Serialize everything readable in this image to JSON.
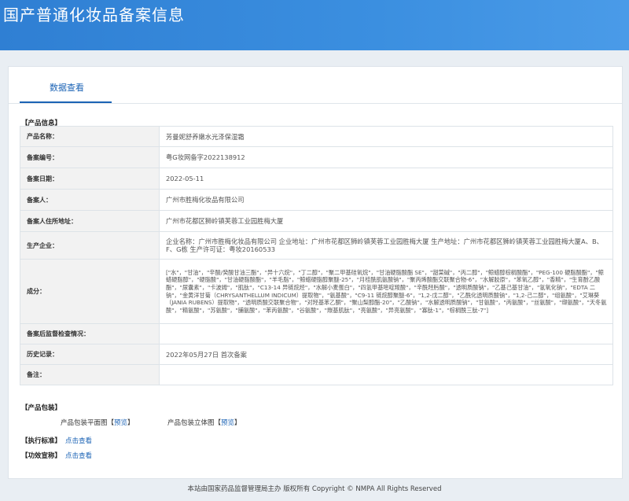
{
  "header": {
    "title": "国产普通化妆品备案信息"
  },
  "tab": {
    "label": "数据查看"
  },
  "product_section": {
    "title": "【产品信息】"
  },
  "rows": [
    {
      "label": "产品名称：",
      "value": "芳曼妮舒养嫩水光泽保湿霜"
    },
    {
      "label": "备案编号：",
      "value": "粤G妆网备字2022138912"
    },
    {
      "label": "备案日期：",
      "value": "2022-05-11"
    },
    {
      "label": "备案人：",
      "value": "广州市胜梅化妆品有限公司"
    },
    {
      "label": "备案人住所地址：",
      "value": "广州市花都区狮岭镇芙蓉工业园胜梅大厦"
    },
    {
      "label": "生产企业：",
      "value": "企业名称：广州市胜梅化妆品有限公司 企业地址：广州市花都区狮岭镇芙蓉工业园胜梅大厦 生产地址：广州市花都区狮岭镇芙蓉工业园胜梅大厦A、B、F、G栋 生产许可证：粤妆20160533"
    },
    {
      "label": "成分：",
      "value": "[\"水\"，\"甘油\"，\"辛酸/癸酸甘油三酯\"，\"异十六烷\"，\"丁二醇\"，\"聚二甲基硅氧烷\"，\"甘油硬脂酸酯 SE\"，\"甜菜碱\"，\"丙二醇\"，\"鲸蜡醇棕榈酸酯\"，\"PEG-100 硬脂酸酯\"，\"鲸蜡硬脂醇\"，\"硬脂酸\"，\"甘油硬脂酸酯\"，\"羊毛脂\"，\"鲸蜡硬脂醇聚醚-25\"，\"月桂酰肌氨酸钠\"，\"聚丙烯酸酯交联聚合物-6\"，\"水解胶原\"，\"苯氧乙醇\"，\"香精\"，\"生育酚乙酸酯\"，\"尿囊素\"，\"卡波姆\"，\"肌肽\"，\"C13-14 异链烷烃\"，\"水解小麦蛋白\"，\"四氢甲基嘧啶羧酸\"，\"辛酰羟肟酸\"，\"透明质酸钠\"，\"乙基己基甘油\"，\"氢氧化钠\"，\"EDTA 二钠\"，\"金黄洋甘菊（CHRYSANTHELLUM INDICUM）提取物\"，\"氨基酸\"，\"C9-11 链烷醇聚醚-6\"，\"1,2-戊二醇\"，\"乙酰化透明质酸钠\"，\"1,2-己二醇\"，\"组氨酸\"，\"艾琳葵（JANIA RUBENS）提取物\"，\"透明质酸交联聚合物\"，\"对羟基苯乙酮\"，\"聚山梨醇酯-20\"，\"乙酸钠\"，\"水解透明质酸钠\"，\"甘氨酸\"，\"丙氨酸\"，\"丝氨酸\"，\"缬氨酸\"，\"天冬氨酸\"，\"精氨酸\"，\"苏氨酸\"，\"脯氨酸\"，\"苯丙氨酸\"，\"谷氨酸\"，\"羰基肌肽\"，\"亮氨酸\"，\"异亮氨酸\"，\"寡肽-1\"，\"棕榈酰三肽-7\"]"
    },
    {
      "label": "备案后监督检查情况：",
      "value": ""
    },
    {
      "label": "历史记录：",
      "value": "2022年05月27日 首次备案"
    },
    {
      "label": "备注：",
      "value": ""
    }
  ],
  "packaging": {
    "title": "【产品包装】",
    "flat_label": "产品包装平面图",
    "flat_link": "预览",
    "stereo_label": "产品包装立体图",
    "stereo_link": "预览",
    "bracket_open": "【",
    "bracket_close": "】"
  },
  "standard": {
    "title": "【执行标准】",
    "link": "点击查看"
  },
  "efficacy": {
    "title": "【功效宣称】",
    "link": "点击查看"
  },
  "footer": {
    "text": "本站由国家药品监督管理局主办 版权所有 Copyright © NMPA All Rights Reserved"
  }
}
